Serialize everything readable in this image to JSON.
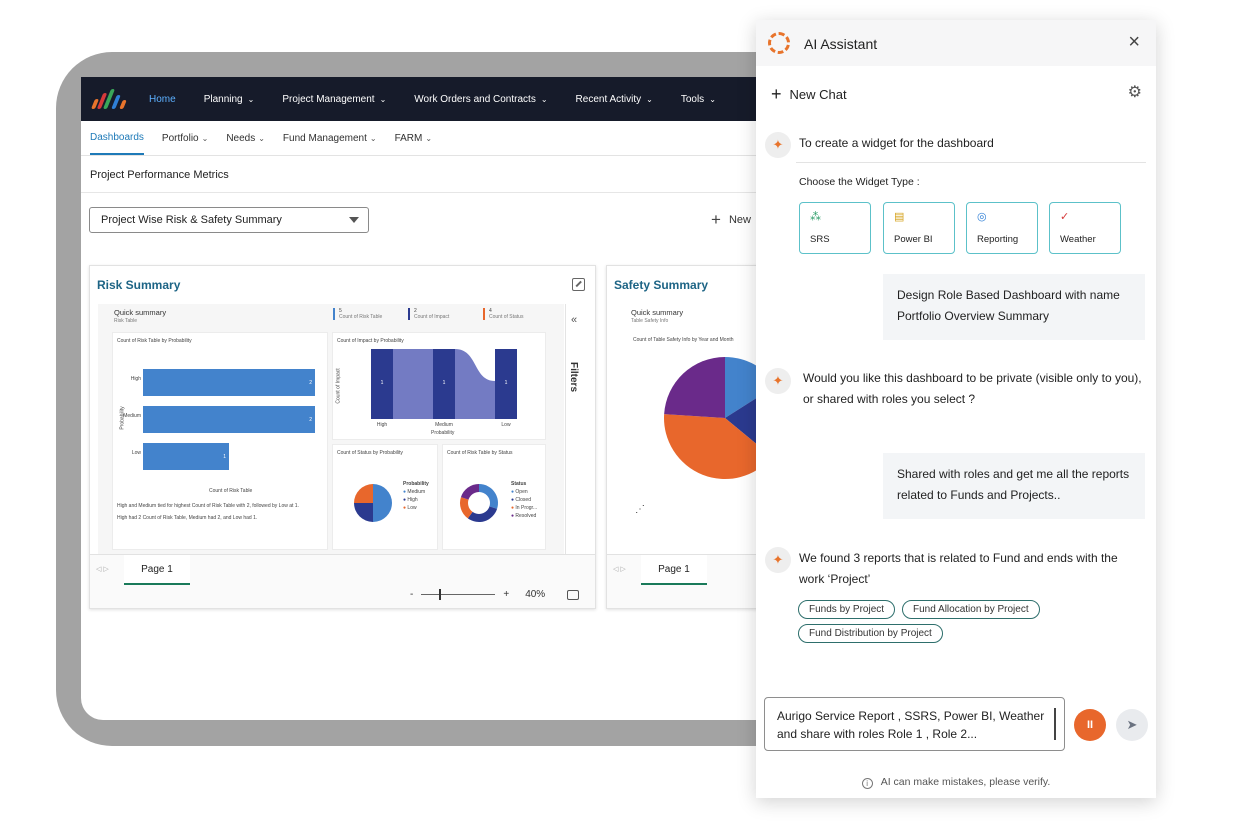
{
  "top_nav": {
    "items": [
      {
        "label": "Home",
        "active": true
      },
      {
        "label": "Planning"
      },
      {
        "label": "Project Management"
      },
      {
        "label": "Work Orders and Contracts"
      },
      {
        "label": "Recent Activity"
      },
      {
        "label": "Tools"
      }
    ],
    "chevron": "⌄"
  },
  "sub_nav": {
    "items": [
      {
        "label": "Dashboards",
        "active": true
      },
      {
        "label": "Portfolio"
      },
      {
        "label": "Needs"
      },
      {
        "label": "Fund Management"
      },
      {
        "label": "FARM"
      }
    ]
  },
  "section_title": "Project Performance Metrics",
  "dashboard_select": {
    "value": "Project Wise Risk & Safety Summary"
  },
  "new_button": {
    "label": "New"
  },
  "risk_card": {
    "title": "Risk Summary",
    "quick_summary": "Quick summary",
    "quick_summary_sub": "Risk Table",
    "kpis": [
      {
        "value": "5",
        "label": "Count of Risk Table"
      },
      {
        "value": "2",
        "label": "Count of Impact"
      },
      {
        "value": "4",
        "label": "Count of Status"
      }
    ],
    "bar_panel_title": "Count of Risk Table by Probability",
    "bar_categories": [
      "High",
      "Medium",
      "Low"
    ],
    "bar_values": [
      2,
      2,
      1
    ],
    "bar_ylabel": "Probability",
    "bar_xlabel": "Count of Risk Table",
    "impact_panel_title": "Count of Impact by Probability",
    "impact_ylabel": "Count of Impact",
    "impact_xlabel": "Probability",
    "impact_categories": [
      "High",
      "Medium",
      "Low"
    ],
    "impact_values": [
      1,
      1,
      1
    ],
    "status_panel_title": "Count of Status by Probability",
    "status_legend_title": "Probability",
    "status_legend": [
      "Medium",
      "High",
      "Low"
    ],
    "risk_status_panel_title": "Count of Risk Table by Status",
    "risk_status_legend_title": "Status",
    "risk_status_legend": [
      "Open",
      "Closed",
      "In Progr...",
      "Resolved"
    ],
    "summary_line1": "High and Medium tied for highest Count of Risk Table with 2, followed by Low at 1.",
    "summary_line2": "High had 2 Count of Risk Table, Medium had 2, and Low had 1.",
    "page_tab": "Page 1",
    "zoom": "40%",
    "filters_label": "Filters"
  },
  "safety_card": {
    "title": "Safety Summary",
    "quick_summary": "Quick summary",
    "quick_summary_sub": "Table Safety Info",
    "pie_panel_title": "Count of Table Safety Info by Year and Month",
    "page_tab": "Page 1"
  },
  "colors": {
    "bar_blue": "#4383cc",
    "dark_navy": "#2b3a8f",
    "orange": "#e8672c",
    "purple": "#6a2a8a",
    "teal_title": "#1d6485",
    "accent_orange": "#e8742c"
  },
  "ai": {
    "title": "AI Assistant",
    "close": "×",
    "new_chat": "New Chat",
    "gear": "⚙",
    "bot_glyph": "✦",
    "msg1": "To create a widget for the dashboard",
    "widget_type_label": "Choose the Widget Type :",
    "widgets": [
      {
        "label": "SRS",
        "icon": "⁂"
      },
      {
        "label": "Power BI",
        "icon": "▤"
      },
      {
        "label": "Reporting",
        "icon": "◎"
      },
      {
        "label": "Weather",
        "icon": "✓"
      }
    ],
    "user1": "Design Role Based Dashboard with name Portfolio Overview Summary",
    "msg2": "Would you like this dashboard to be private (visible only to you), or shared with roles you select ?",
    "user2": "Shared with roles and get me all the reports related to Funds and Projects..",
    "msg3": "We found 3 reports that is related to Fund and ends with the work ‘Project’",
    "chips": [
      "Funds by Project",
      "Fund Allocation by Project",
      "Fund Distribution by Project"
    ],
    "input_value": "Aurigo Service Report , SSRS, Power BI, Weather and share with roles Role 1 , Role 2...",
    "pause_glyph": "II",
    "send_glyph": "➤",
    "info_glyph": "i",
    "disclaimer": "AI can make mistakes, please verify."
  }
}
